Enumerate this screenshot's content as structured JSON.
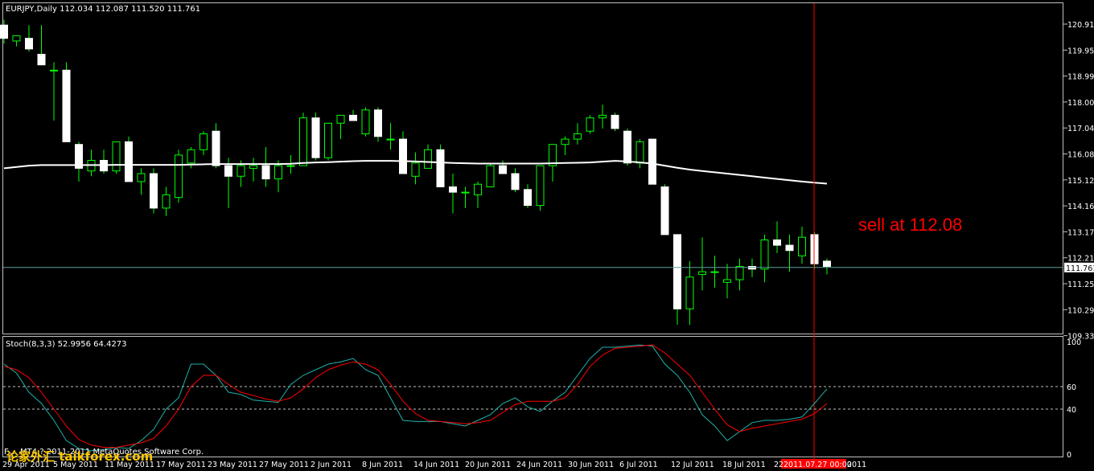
{
  "header": {
    "symbol_line": "EURJPY,Daily  112.034 112.087 111.520 111.761"
  },
  "annotation": {
    "text": "sell at 112.08"
  },
  "stoch": {
    "label": "Stoch(8,3,3) 52.9956 64.4273",
    "levels": [
      "100",
      "60",
      "40",
      "0"
    ],
    "level_values": [
      100,
      60,
      40,
      0
    ]
  },
  "price_axis": {
    "labels": [
      "120.910",
      "119.950",
      "118.990",
      "118.000",
      "117.040",
      "116.080",
      "115.120",
      "114.160",
      "113.170",
      "112.210",
      "111.250",
      "110.290",
      "109.330"
    ],
    "current_price": "111.761"
  },
  "dates": {
    "labels": [
      "29 Apr 2011",
      "5 May 2011",
      "11 May 2011",
      "17 May 2011",
      "23 May 2011",
      "27 May 2011",
      "2 Jun 2011",
      "8 Jun 2011",
      "14 Jun 2011",
      "20 Jun 2011",
      "24 Jun 2011",
      "30 Jun 2011",
      "6 Jul 2011",
      "12 Jul 2011",
      "18 Jul 2011",
      "22",
      "2011",
      "2011.07.27 00:00"
    ]
  },
  "watermark": {
    "text": "F.... MT4 ? 2011-2011 MetaQuotes Software Corp.",
    "logo_text": "论家外汇 taikforex.com"
  },
  "colors": {
    "background": "#000000",
    "grid": "#c0c0c0",
    "bull_wick": "#00ff00",
    "bull_body": "#000000",
    "bear_body": "#ffffff",
    "ma_line": "#ffffff",
    "price_line": "#708090",
    "vertical_marker": "#ff0000",
    "stoch_main": "#20b2aa",
    "stoch_signal": "#ff0000",
    "annotation": "#ff0000",
    "date_highlight_bg": "#ff0000"
  },
  "chart_data": {
    "type": "candlestick",
    "symbol": "EURJPY",
    "timeframe": "Daily",
    "price_range": [
      109.33,
      121.3
    ],
    "candles": [
      {
        "o": 120.9,
        "h": 121.1,
        "l": 120.2,
        "c": 120.4
      },
      {
        "o": 120.3,
        "h": 120.5,
        "l": 120.1,
        "c": 120.5
      },
      {
        "o": 120.4,
        "h": 120.9,
        "l": 119.9,
        "c": 120.0
      },
      {
        "o": 119.8,
        "h": 120.9,
        "l": 119.4,
        "c": 119.4
      },
      {
        "o": 119.2,
        "h": 119.5,
        "l": 117.3,
        "c": 119.2
      },
      {
        "o": 119.2,
        "h": 119.5,
        "l": 116.5,
        "c": 116.5
      },
      {
        "o": 116.4,
        "h": 116.5,
        "l": 115.0,
        "c": 115.5
      },
      {
        "o": 115.4,
        "h": 116.2,
        "l": 115.2,
        "c": 115.8
      },
      {
        "o": 115.8,
        "h": 116.2,
        "l": 115.3,
        "c": 115.4
      },
      {
        "o": 115.4,
        "h": 116.5,
        "l": 115.3,
        "c": 116.5
      },
      {
        "o": 116.5,
        "h": 116.7,
        "l": 115.0,
        "c": 115.0
      },
      {
        "o": 115.0,
        "h": 115.5,
        "l": 114.5,
        "c": 115.3
      },
      {
        "o": 115.3,
        "h": 115.5,
        "l": 113.8,
        "c": 114.0
      },
      {
        "o": 114.0,
        "h": 114.8,
        "l": 113.7,
        "c": 114.5
      },
      {
        "o": 114.4,
        "h": 116.2,
        "l": 114.2,
        "c": 116.0
      },
      {
        "o": 115.7,
        "h": 116.3,
        "l": 115.5,
        "c": 116.2
      },
      {
        "o": 116.2,
        "h": 116.9,
        "l": 116.0,
        "c": 116.8
      },
      {
        "o": 116.9,
        "h": 117.2,
        "l": 115.5,
        "c": 115.6
      },
      {
        "o": 115.6,
        "h": 115.9,
        "l": 114.0,
        "c": 115.2
      },
      {
        "o": 115.2,
        "h": 115.8,
        "l": 114.8,
        "c": 115.6
      },
      {
        "o": 115.5,
        "h": 115.9,
        "l": 115.0,
        "c": 115.6
      },
      {
        "o": 115.6,
        "h": 116.3,
        "l": 114.8,
        "c": 115.1
      },
      {
        "o": 115.1,
        "h": 115.8,
        "l": 114.6,
        "c": 115.6
      },
      {
        "o": 115.6,
        "h": 116.0,
        "l": 115.3,
        "c": 115.6
      },
      {
        "o": 115.6,
        "h": 117.6,
        "l": 115.6,
        "c": 117.4
      },
      {
        "o": 117.4,
        "h": 117.6,
        "l": 115.8,
        "c": 115.9
      },
      {
        "o": 115.9,
        "h": 117.2,
        "l": 115.8,
        "c": 117.2
      },
      {
        "o": 117.2,
        "h": 117.5,
        "l": 116.6,
        "c": 117.5
      },
      {
        "o": 117.5,
        "h": 117.7,
        "l": 117.3,
        "c": 117.3
      },
      {
        "o": 116.8,
        "h": 117.8,
        "l": 116.7,
        "c": 117.7
      },
      {
        "o": 117.7,
        "h": 117.8,
        "l": 116.5,
        "c": 116.7
      },
      {
        "o": 116.6,
        "h": 117.2,
        "l": 116.2,
        "c": 116.6
      },
      {
        "o": 116.6,
        "h": 116.9,
        "l": 115.3,
        "c": 115.3
      },
      {
        "o": 115.2,
        "h": 116.1,
        "l": 114.9,
        "c": 115.7
      },
      {
        "o": 115.5,
        "h": 116.4,
        "l": 115.5,
        "c": 116.2
      },
      {
        "o": 116.2,
        "h": 116.4,
        "l": 114.8,
        "c": 114.8
      },
      {
        "o": 114.8,
        "h": 115.3,
        "l": 113.8,
        "c": 114.6
      },
      {
        "o": 114.6,
        "h": 114.8,
        "l": 114.0,
        "c": 114.6
      },
      {
        "o": 114.5,
        "h": 115.0,
        "l": 114.0,
        "c": 114.9
      },
      {
        "o": 114.8,
        "h": 115.7,
        "l": 114.8,
        "c": 115.6
      },
      {
        "o": 115.6,
        "h": 115.8,
        "l": 115.3,
        "c": 115.3
      },
      {
        "o": 115.3,
        "h": 115.5,
        "l": 114.6,
        "c": 114.7
      },
      {
        "o": 114.7,
        "h": 114.9,
        "l": 114.0,
        "c": 114.1
      },
      {
        "o": 114.1,
        "h": 115.6,
        "l": 113.9,
        "c": 115.6
      },
      {
        "o": 115.6,
        "h": 116.4,
        "l": 115.0,
        "c": 116.4
      },
      {
        "o": 116.4,
        "h": 116.7,
        "l": 116.0,
        "c": 116.6
      },
      {
        "o": 116.6,
        "h": 117.2,
        "l": 116.4,
        "c": 116.8
      },
      {
        "o": 116.9,
        "h": 117.5,
        "l": 116.8,
        "c": 117.4
      },
      {
        "o": 117.4,
        "h": 117.9,
        "l": 117.0,
        "c": 117.5
      },
      {
        "o": 117.5,
        "h": 117.6,
        "l": 116.9,
        "c": 117.0
      },
      {
        "o": 116.9,
        "h": 117.0,
        "l": 115.6,
        "c": 115.7
      },
      {
        "o": 115.7,
        "h": 116.6,
        "l": 115.5,
        "c": 116.5
      },
      {
        "o": 116.6,
        "h": 116.6,
        "l": 114.9,
        "c": 114.9
      },
      {
        "o": 114.8,
        "h": 114.9,
        "l": 113.0,
        "c": 113.0
      },
      {
        "o": 113.0,
        "h": 113.0,
        "l": 109.6,
        "c": 110.2
      },
      {
        "o": 110.2,
        "h": 112.0,
        "l": 109.6,
        "c": 111.4
      },
      {
        "o": 111.5,
        "h": 112.9,
        "l": 110.9,
        "c": 111.6
      },
      {
        "o": 111.6,
        "h": 112.2,
        "l": 111.0,
        "c": 111.6
      },
      {
        "o": 111.2,
        "h": 111.9,
        "l": 110.6,
        "c": 111.3
      },
      {
        "o": 111.3,
        "h": 112.1,
        "l": 110.9,
        "c": 111.8
      },
      {
        "o": 111.8,
        "h": 112.1,
        "l": 111.4,
        "c": 111.7
      },
      {
        "o": 111.7,
        "h": 113.0,
        "l": 111.2,
        "c": 112.8
      },
      {
        "o": 112.8,
        "h": 113.5,
        "l": 112.3,
        "c": 112.6
      },
      {
        "o": 112.6,
        "h": 113.0,
        "l": 111.6,
        "c": 112.4
      },
      {
        "o": 112.2,
        "h": 113.3,
        "l": 111.9,
        "c": 112.9
      },
      {
        "o": 113.0,
        "h": 113.1,
        "l": 111.7,
        "c": 111.9
      },
      {
        "o": 112.0,
        "h": 112.1,
        "l": 111.5,
        "c": 111.8
      }
    ],
    "moving_average": [
      115.5,
      115.55,
      115.6,
      115.62,
      115.62,
      115.62,
      115.62,
      115.62,
      115.62,
      115.63,
      115.63,
      115.63,
      115.63,
      115.63,
      115.63,
      115.64,
      115.65,
      115.66,
      115.66,
      115.66,
      115.66,
      115.66,
      115.66,
      115.67,
      115.7,
      115.72,
      115.73,
      115.75,
      115.77,
      115.78,
      115.78,
      115.78,
      115.77,
      115.76,
      115.74,
      115.72,
      115.7,
      115.69,
      115.68,
      115.68,
      115.68,
      115.68,
      115.68,
      115.68,
      115.69,
      115.7,
      115.71,
      115.72,
      115.75,
      115.78,
      115.76,
      115.72,
      115.68,
      115.6,
      115.52,
      115.45,
      115.4,
      115.35,
      115.3,
      115.25,
      115.2,
      115.15,
      115.1,
      115.05,
      115.0,
      114.96,
      114.92
    ],
    "stoch_main": [
      80,
      72,
      55,
      45,
      30,
      12,
      5,
      3,
      4,
      6,
      5,
      12,
      22,
      40,
      50,
      80,
      80,
      70,
      55,
      53,
      48,
      47,
      46,
      62,
      70,
      75,
      80,
      82,
      85,
      75,
      70,
      50,
      30,
      29,
      29,
      29,
      27,
      25,
      30,
      35,
      45,
      50,
      42,
      38,
      47,
      55,
      70,
      85,
      95,
      95,
      96,
      97,
      96,
      80,
      70,
      55,
      35,
      25,
      12,
      20,
      28,
      30,
      30,
      31,
      33,
      45,
      58
    ],
    "stoch_signal": [
      78,
      75,
      68,
      55,
      40,
      25,
      13,
      8,
      6,
      6,
      8,
      10,
      14,
      25,
      40,
      60,
      70,
      70,
      62,
      55,
      52,
      49,
      47,
      50,
      58,
      68,
      75,
      79,
      82,
      80,
      75,
      62,
      47,
      36,
      30,
      29,
      28,
      27,
      28,
      30,
      37,
      44,
      47,
      47,
      47,
      50,
      62,
      78,
      88,
      94,
      95,
      96,
      97,
      90,
      80,
      70,
      55,
      40,
      26,
      20,
      23,
      25,
      27,
      29,
      31,
      36,
      45
    ]
  }
}
